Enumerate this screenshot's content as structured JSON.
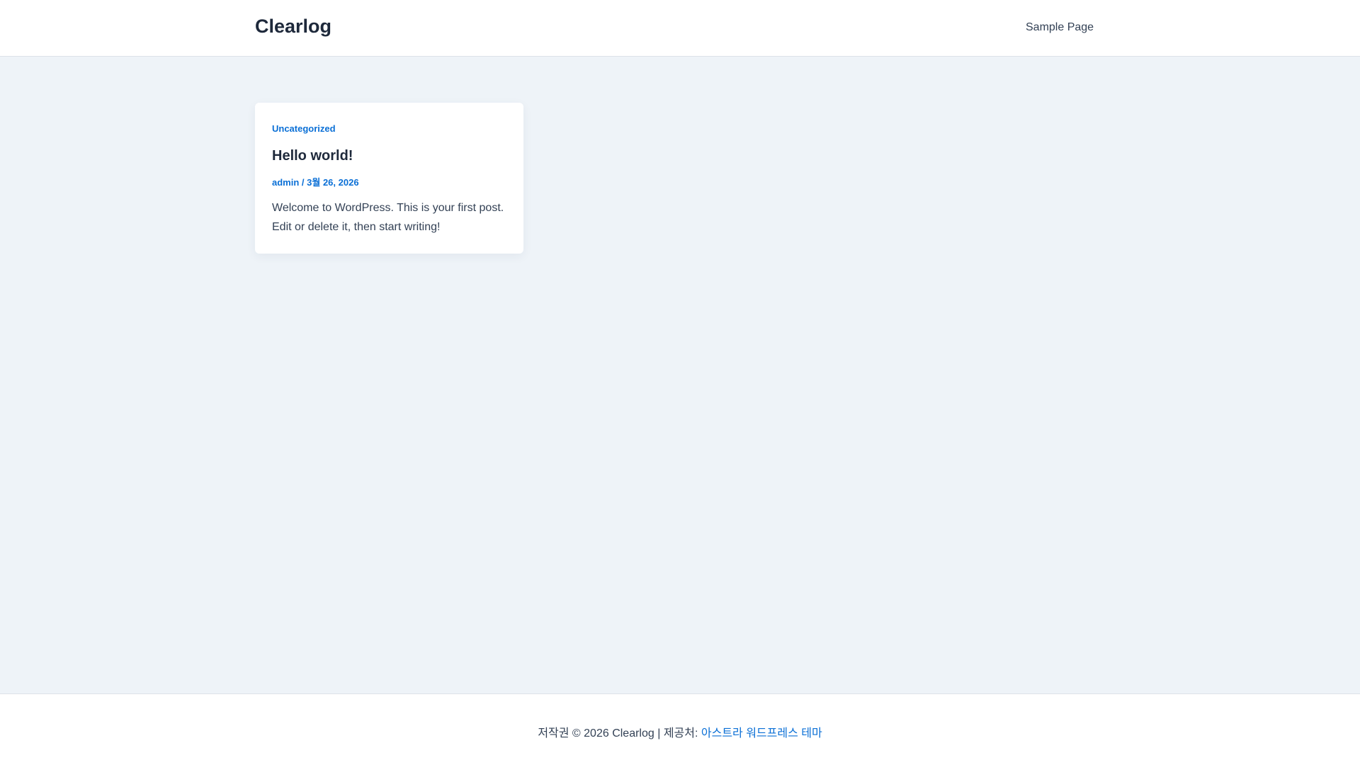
{
  "header": {
    "site_title": "Clearlog",
    "nav": [
      {
        "label": "Sample Page"
      }
    ]
  },
  "post": {
    "category": "Uncategorized",
    "title": "Hello world!",
    "author": "admin",
    "separator": " / ",
    "date": "3월 26, 2026",
    "excerpt": "Welcome to WordPress. This is your first post. Edit or delete it, then start writing!"
  },
  "footer": {
    "copyright": "저작권 © 2026 Clearlog | 제공처: ",
    "theme_link": "아스트라 워드프레스 테마"
  },
  "colors": {
    "accent": "#0a6fd6",
    "background": "#eef3f8",
    "heading": "#1e293b",
    "text": "#334155"
  }
}
